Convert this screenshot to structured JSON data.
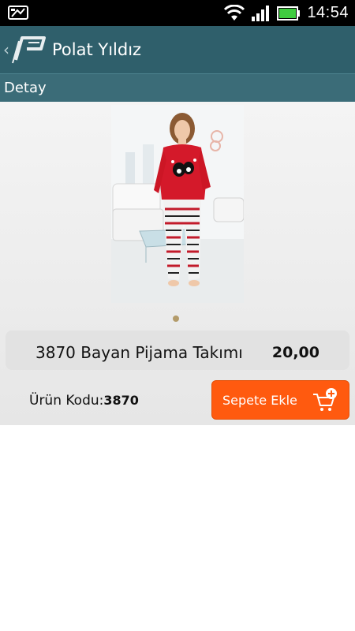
{
  "status_bar": {
    "time": "14:54",
    "icons": [
      "notification-icon",
      "wifi-icon",
      "signal-icon",
      "battery-icon"
    ]
  },
  "action_bar": {
    "title": "Polat Yıldız",
    "icons": [
      "back-chevron-icon",
      "app-logo-icon"
    ]
  },
  "section": {
    "title": "Detay"
  },
  "product": {
    "name": "3870 Bayan Pijama Takımı",
    "price": "20,00",
    "code_label": "Ürün Kodu:",
    "code_value": "3870",
    "image_description_icon": "product-photo",
    "pager_pages": 1,
    "pager_current": 1
  },
  "cart_button": {
    "label": "Sepete Ekle",
    "icon": "add-to-cart-icon"
  },
  "colors": {
    "action_bar": "#2f5f6b",
    "section_header": "#3b6c78",
    "accent": "#ff5a0f"
  }
}
